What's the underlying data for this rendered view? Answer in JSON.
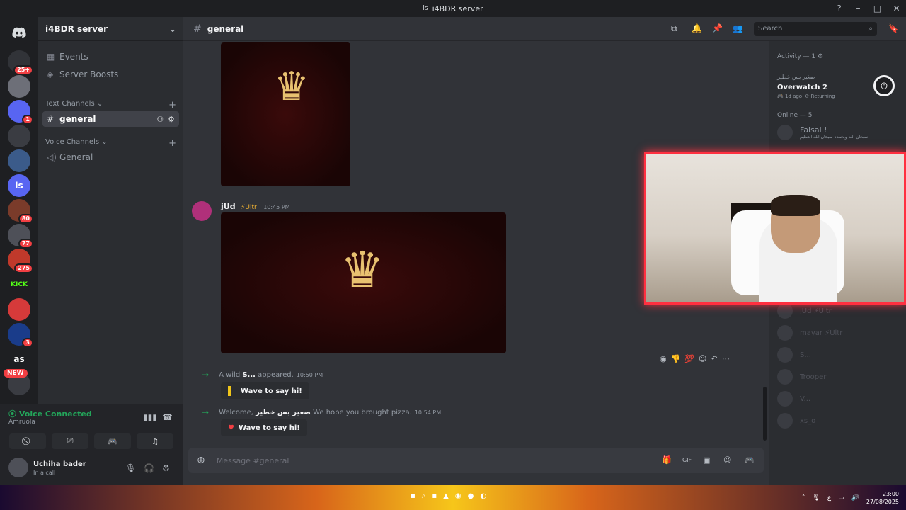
{
  "window": {
    "title": "i4BDR server",
    "server_icon_label": "is"
  },
  "servers": [
    {
      "label": "",
      "badge": "25+",
      "color": "#313338"
    },
    {
      "label": "",
      "badge": "",
      "color": "#6d6f78"
    },
    {
      "label": "",
      "badge": "1",
      "color": "#5865f2"
    },
    {
      "label": "",
      "badge": "",
      "color": "#3a3c42"
    },
    {
      "label": "",
      "badge": "",
      "color": "#3b5b8a"
    },
    {
      "label": "is",
      "badge": "",
      "color": "#5865f2"
    },
    {
      "label": "",
      "badge": "80",
      "color": "#7a3b2a"
    },
    {
      "label": "",
      "badge": "77",
      "color": "#4e5058"
    },
    {
      "label": "",
      "badge": "275",
      "color": "#c0392b"
    },
    {
      "label": "KICK",
      "badge": "",
      "color": "#1e1f22"
    },
    {
      "label": "",
      "badge": "",
      "color": "#d63a3a"
    },
    {
      "label": "",
      "badge": "3",
      "color": "#1a3c8a"
    },
    {
      "label": "as",
      "badge": "",
      "color": "#1e1f22"
    },
    {
      "label": "",
      "badge": "",
      "color": "#3a3c42"
    }
  ],
  "new_badge": "NEW",
  "sidebar": {
    "guild_name": "i4BDR server",
    "events": "Events",
    "boosts": "Server Boosts",
    "text_category": "Text Channels",
    "active_channel": "general",
    "voice_category": "Voice Channels",
    "voice_channel": "General"
  },
  "voice": {
    "status": "Voice Connected",
    "location": "Amruola"
  },
  "user": {
    "name": "Uchiha bader",
    "status": "In a call"
  },
  "header": {
    "channel": "general",
    "search_placeholder": "Search"
  },
  "messages": {
    "author": "jUd",
    "author_badge": "⚡Ultr",
    "time": "10:45 PM",
    "system1": {
      "prefix": "A wild",
      "name": "S...",
      "suffix": "appeared.",
      "time": "10:50 PM"
    },
    "system2": {
      "prefix": "Welcome,",
      "name": "صغير بس خطير",
      "suffix": "We hope you brought pizza.",
      "time": "10:54 PM"
    },
    "wave_label": "Wave to say hi!"
  },
  "composer": {
    "placeholder": "Message #general"
  },
  "members": {
    "activity_heading": "Activity — 1",
    "activity_user": "صغير بس خطير",
    "activity_game": "Overwatch 2",
    "activity_meta": "1d ago",
    "activity_status": "Returning",
    "online_heading": "Online — 5",
    "online": [
      {
        "name": "Faisal !",
        "sub": "سبحان الله وبحمده سبحان الله العظيم"
      }
    ],
    "offline": [
      "jUd ⚡Ultr",
      "mayar ⚡Ultr",
      "S...",
      "Trooper",
      "V...",
      "xs_o"
    ]
  },
  "taskbar": {
    "time": "23:00",
    "date": "27/08/2025",
    "lang": "ع"
  }
}
